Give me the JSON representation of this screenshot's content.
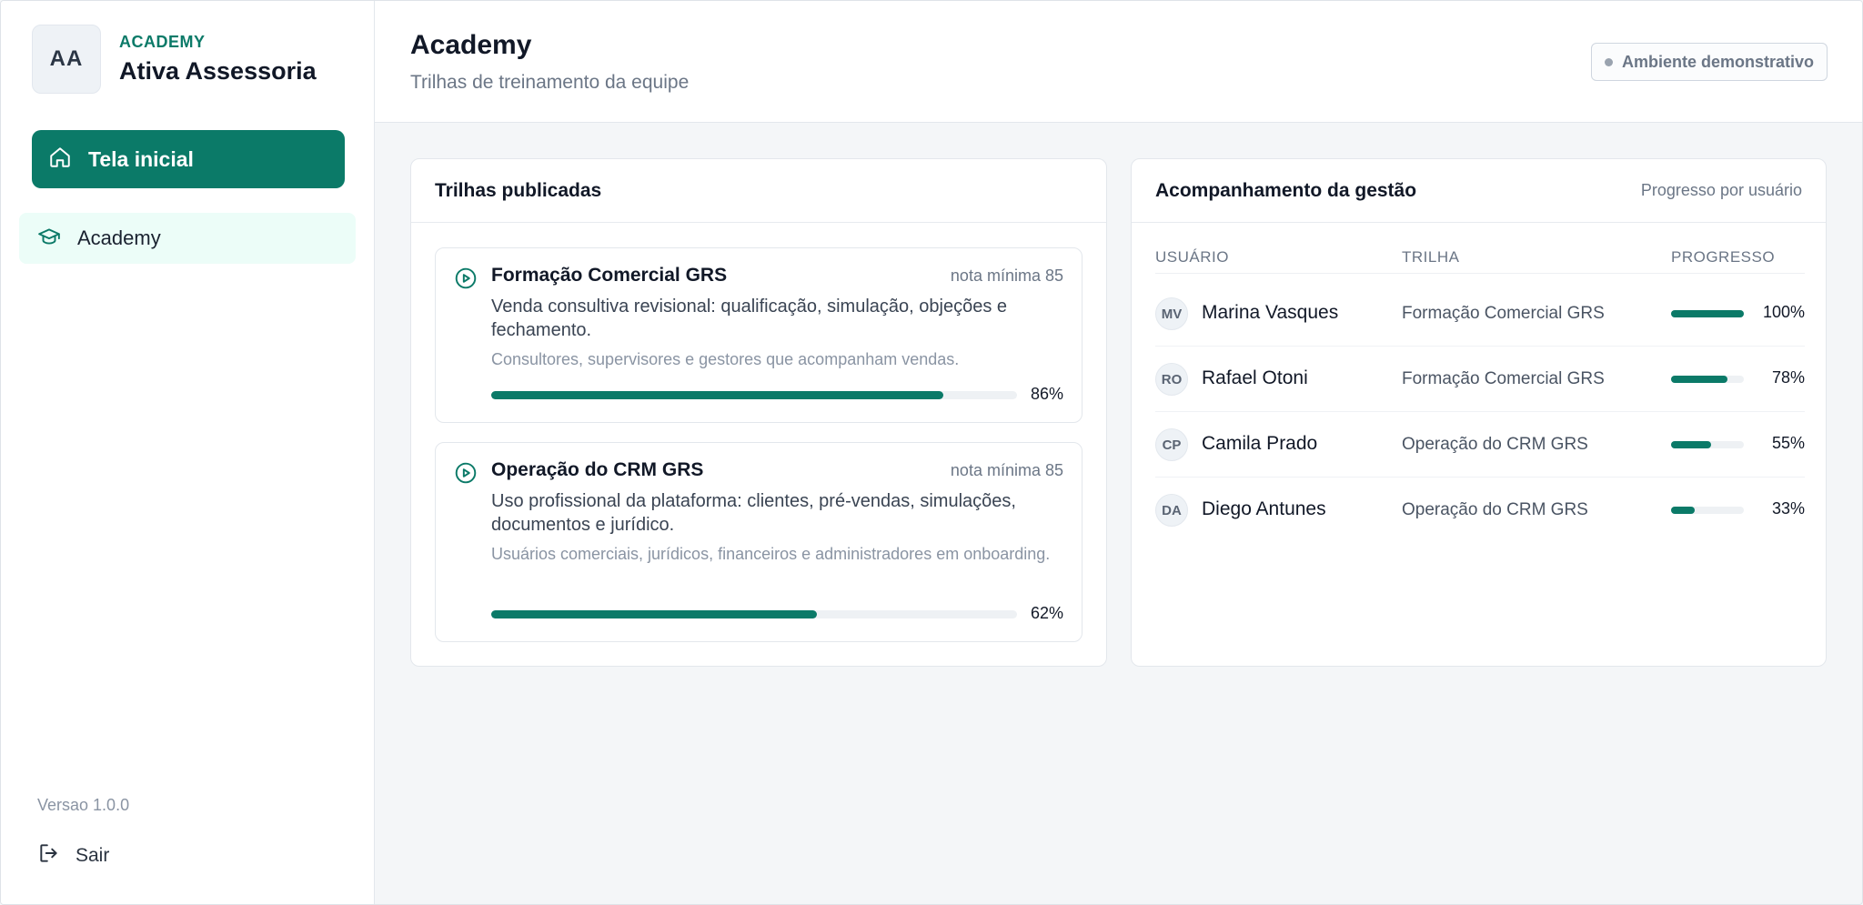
{
  "sidebar": {
    "avatar_initials": "AA",
    "brand_tag": "ACADEMY",
    "brand_name": "Ativa Assessoria",
    "nav": [
      {
        "label": "Tela inicial",
        "icon": "home-icon",
        "active": true
      },
      {
        "label": "Academy",
        "icon": "graduation-cap-icon",
        "active": false
      }
    ],
    "version": "Versao 1.0.0",
    "logout_label": "Sair"
  },
  "header": {
    "title": "Academy",
    "subtitle": "Trilhas de treinamento da equipe",
    "env_badge": "Ambiente demonstrativo"
  },
  "tracks_card": {
    "title": "Trilhas publicadas",
    "items": [
      {
        "name": "Formação Comercial GRS",
        "min_grade": "nota mínima 85",
        "description": "Venda consultiva revisional: qualificação, simulação, objeções e fechamento.",
        "audience": "Consultores, supervisores e gestores que acompanham vendas.",
        "progress": 86,
        "progress_label": "86%"
      },
      {
        "name": "Operação do CRM GRS",
        "min_grade": "nota mínima 85",
        "description": "Uso profissional da plataforma: clientes, pré-vendas, simulações, documentos e jurídico.",
        "audience": "Usuários comerciais, jurídicos, financeiros e administradores em onboarding.",
        "progress": 62,
        "progress_label": "62%"
      }
    ]
  },
  "management_card": {
    "title": "Acompanhamento da gestão",
    "hint": "Progresso por usuário",
    "columns": [
      "USUÁRIO",
      "TRILHA",
      "PROGRESSO"
    ],
    "rows": [
      {
        "initials": "MV",
        "name": "Marina Vasques",
        "track": "Formação Comercial GRS",
        "progress": 100,
        "progress_label": "100%"
      },
      {
        "initials": "RO",
        "name": "Rafael Otoni",
        "track": "Formação Comercial GRS",
        "progress": 78,
        "progress_label": "78%"
      },
      {
        "initials": "CP",
        "name": "Camila Prado",
        "track": "Operação do CRM GRS",
        "progress": 55,
        "progress_label": "55%"
      },
      {
        "initials": "DA",
        "name": "Diego Antunes",
        "track": "Operação do CRM GRS",
        "progress": 33,
        "progress_label": "33%"
      }
    ]
  },
  "colors": {
    "accent": "#0b7a68",
    "accent_soft": "#ecfdf8",
    "track_bg": "#eef1f4"
  }
}
